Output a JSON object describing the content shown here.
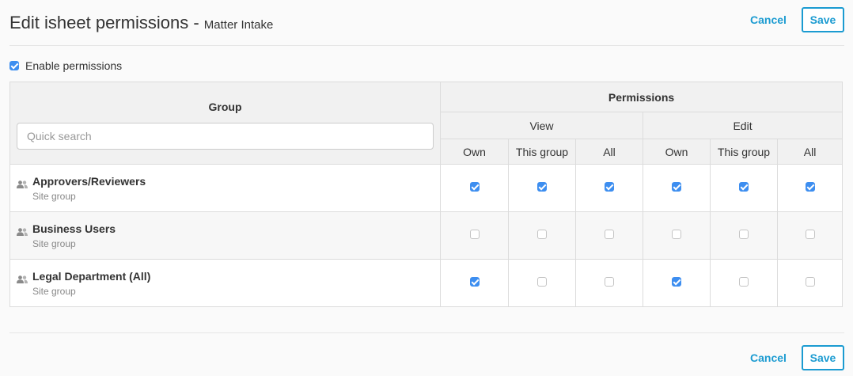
{
  "header": {
    "title": "Edit isheet permissions",
    "separator": " - ",
    "subtitle": "Matter Intake",
    "cancel_label": "Cancel",
    "save_label": "Save"
  },
  "enable": {
    "label": "Enable permissions",
    "checked": true
  },
  "table": {
    "group_header": "Group",
    "search_placeholder": "Quick search",
    "permissions_header": "Permissions",
    "view_header": "View",
    "edit_header": "Edit",
    "columns": [
      "Own",
      "This group",
      "All",
      "Own",
      "This group",
      "All"
    ],
    "rows": [
      {
        "name": "Approvers/Reviewers",
        "type": "Site group",
        "perms": [
          true,
          true,
          true,
          true,
          true,
          true
        ]
      },
      {
        "name": "Business Users",
        "type": "Site group",
        "perms": [
          false,
          false,
          false,
          false,
          false,
          false
        ]
      },
      {
        "name": "Legal Department (All)",
        "type": "Site group",
        "perms": [
          true,
          false,
          false,
          true,
          false,
          false
        ]
      }
    ]
  },
  "footer": {
    "cancel_label": "Cancel",
    "save_label": "Save"
  },
  "colors": {
    "accent": "#1b9bd1",
    "checkbox": "#3d8ef0"
  }
}
